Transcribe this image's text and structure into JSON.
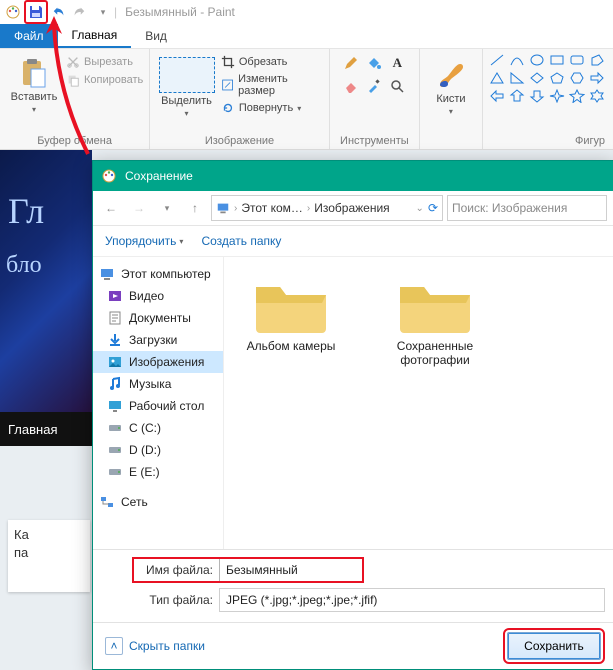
{
  "window_title": "Безымянный - Paint",
  "tabs": {
    "file": "Файл",
    "home": "Главная",
    "view": "Вид"
  },
  "ribbon": {
    "paste": {
      "label": "Вставить"
    },
    "clipboard": {
      "cut": "Вырезать",
      "copy": "Копировать",
      "group": "Буфер обмена"
    },
    "select": {
      "label": "Выделить"
    },
    "image": {
      "crop": "Обрезать",
      "resize": "Изменить размер",
      "rotate": "Повернуть",
      "group": "Изображение"
    },
    "tools": {
      "group": "Инструменты"
    },
    "brushes": {
      "label": "Кисти"
    },
    "shapes": {
      "group": "Фигур"
    }
  },
  "canvas": {
    "line1": "Гл",
    "line2": "бло",
    "nav": "Главная",
    "card1": "Ка",
    "card2": "па"
  },
  "dialog": {
    "title": "Сохранение",
    "breadcrumb": {
      "pc": "Этот ком…",
      "folder": "Изображения"
    },
    "search_placeholder": "Поиск: Изображения",
    "toolbar": {
      "organize": "Упорядочить",
      "new_folder": "Создать папку"
    },
    "tree": {
      "this_pc": "Этот компьютер",
      "videos": "Видео",
      "documents": "Документы",
      "downloads": "Загрузки",
      "pictures": "Изображения",
      "music": "Музыка",
      "desktop": "Рабочий стол",
      "drive_c": "C (C:)",
      "drive_d": "D (D:)",
      "drive_e": "E (E:)",
      "network": "Сеть"
    },
    "folders": {
      "camera": "Альбом камеры",
      "saved": "Сохраненные фотографии"
    },
    "filename_label": "Имя файла:",
    "filename_value": "Безымянный",
    "filetype_label": "Тип файла:",
    "filetype_value": "JPEG (*.jpg;*.jpeg;*.jpe;*.jfif)",
    "hide_folders": "Скрыть папки",
    "save_btn": "Сохранить"
  }
}
